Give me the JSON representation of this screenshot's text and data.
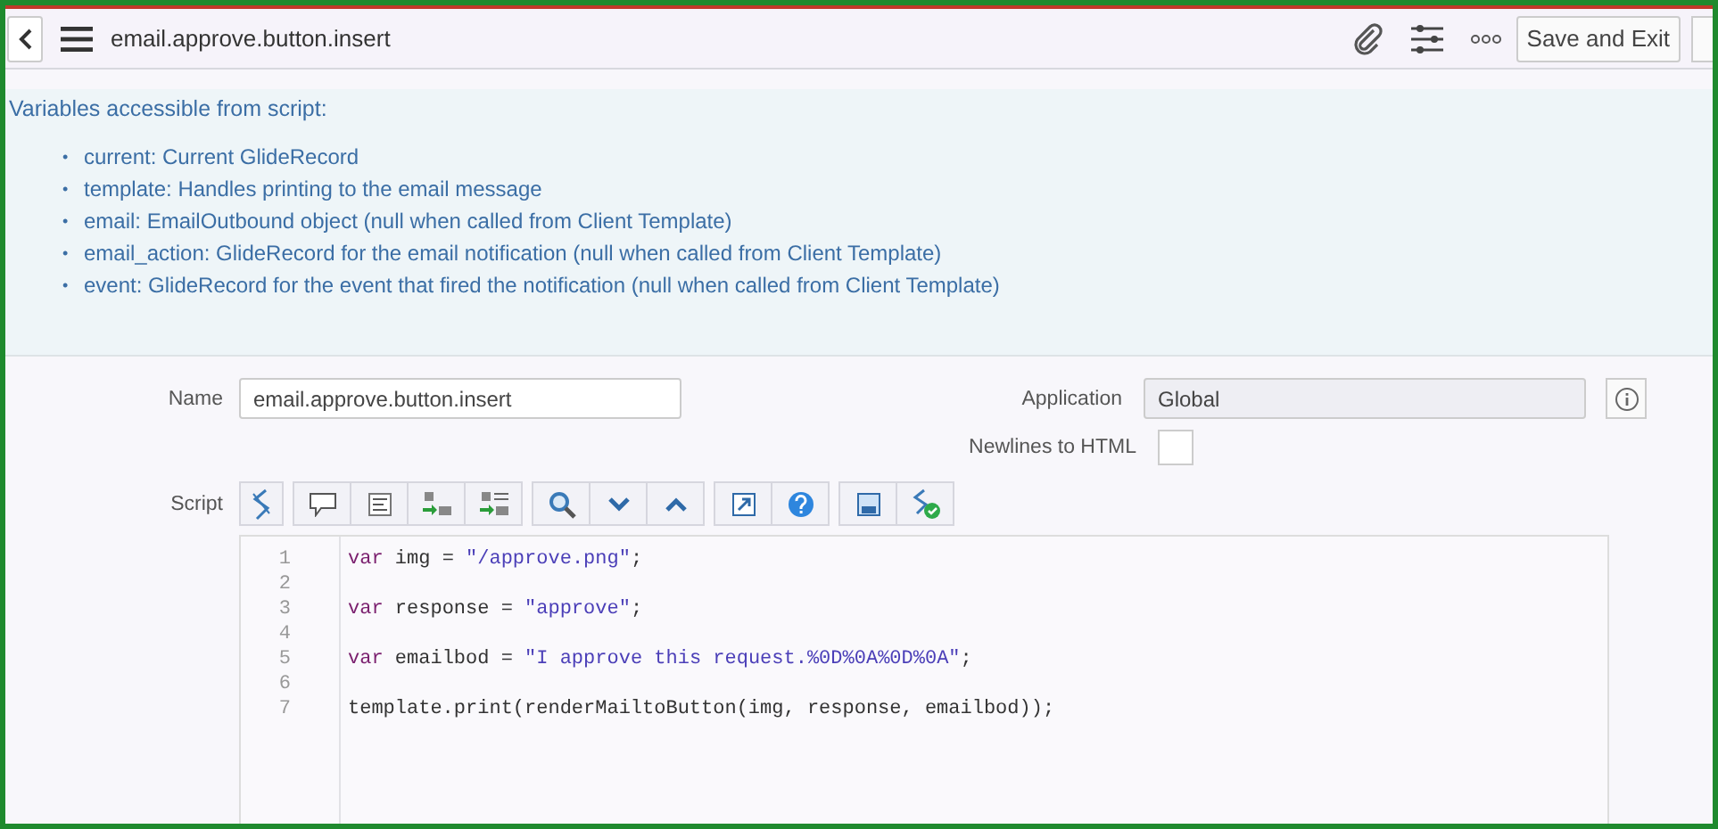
{
  "header": {
    "title": "email.approve.button.insert",
    "save_button": "Save and Exit"
  },
  "info": {
    "heading": "Variables accessible from script:",
    "items": [
      {
        "marker": "•",
        "text": "current: Current GlideRecord"
      },
      {
        "marker": "•",
        "text": "template: Handles printing to the email message"
      },
      {
        "marker": "•",
        "text": "email: EmailOutbound object (null when called from Client Template)"
      },
      {
        "marker": "•",
        "text": "email_action: GlideRecord for the email notification (null when called from Client Template)"
      },
      {
        "marker": "•",
        "text": "event: GlideRecord for the event that fired the notification (null when called from Client Template)"
      }
    ]
  },
  "form": {
    "name_label": "Name",
    "name_value": "email.approve.button.insert",
    "application_label": "Application",
    "application_value": "Global",
    "newlines_label": "Newlines to HTML",
    "newlines_checked": false,
    "script_label": "Script"
  },
  "code": [
    {
      "number": "1",
      "tokens": [
        {
          "kind": "keyword",
          "text": "var"
        },
        {
          "kind": "plain",
          "text": " img = "
        },
        {
          "kind": "string",
          "text": "\"/approve.png\""
        },
        {
          "kind": "plain",
          "text": ";"
        }
      ]
    },
    {
      "number": "2"
    },
    {
      "number": "3",
      "tokens": [
        {
          "kind": "keyword",
          "text": "var"
        },
        {
          "kind": "plain",
          "text": " response = "
        },
        {
          "kind": "string",
          "text": "\"approve\""
        },
        {
          "kind": "plain",
          "text": ";"
        }
      ]
    },
    {
      "number": "4"
    },
    {
      "number": "5",
      "tokens": [
        {
          "kind": "keyword",
          "text": "var"
        },
        {
          "kind": "plain",
          "text": " emailbod = "
        },
        {
          "kind": "string",
          "text": "\"I approve this request.%0D%0A%0D%0A\""
        },
        {
          "kind": "plain",
          "text": ";"
        }
      ]
    },
    {
      "number": "6"
    },
    {
      "number": "7",
      "tokens": [
        {
          "kind": "plain",
          "text": "template.print(renderMailtoButton(img, response, emailbod));"
        }
      ]
    }
  ]
}
